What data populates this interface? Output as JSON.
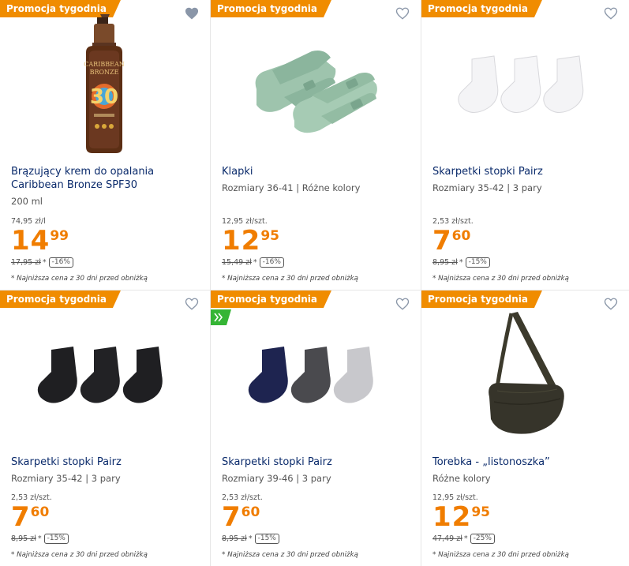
{
  "promo_label": "Promocja tygodnia",
  "colors": {
    "promo": "#f08c00",
    "price": "#f07d00",
    "title": "#0a2a6b",
    "green_badge": "#35b535"
  },
  "products": [
    {
      "promo": "Promocja tygodnia",
      "favorite_active": true,
      "image": "sunscreen-bottle-image",
      "title": "Brązujący krem do opalania Caribbean Bronze SPF30",
      "subtitle": "200 ml",
      "unit_price": "74,95 zł/l",
      "price_main": "14",
      "price_cents": "99",
      "old_price": "17,95 zł",
      "discount": "-16%",
      "note": "* Najniższa cena z 30 dni przed obniżką"
    },
    {
      "promo": "Promocja tygodnia",
      "favorite_active": false,
      "image": "slippers-image",
      "title": "Klapki",
      "subtitle": "Rozmiary 36-41 | Różne kolory",
      "unit_price": "12,95 zł/szt.",
      "price_main": "12",
      "price_cents": "95",
      "old_price": "15,49 zł",
      "discount": "-16%",
      "note": "* Najniższa cena z 30 dni przed obniżką"
    },
    {
      "promo": "Promocja tygodnia",
      "favorite_active": false,
      "image": "white-socks-image",
      "title": "Skarpetki stopki Pairz",
      "subtitle": "Rozmiary 35-42 | 3 pary",
      "unit_price": "2,53 zł/szt.",
      "price_main": "7",
      "price_cents": "60",
      "old_price": "8,95 zł",
      "discount": "-15%",
      "note": "* Najniższa cena z 30 dni przed obniżką"
    },
    {
      "promo": "Promocja tygodnia",
      "favorite_active": false,
      "image": "black-socks-image",
      "title": "Skarpetki stopki Pairz",
      "subtitle": "Rozmiary 35-42 | 3 pary",
      "unit_price": "2,53 zł/szt.",
      "price_main": "7",
      "price_cents": "60",
      "old_price": "8,95 zł",
      "discount": "-15%",
      "note": "* Najniższa cena z 30 dni przed obniżką"
    },
    {
      "promo": "Promocja tygodnia",
      "favorite_active": false,
      "green_badge": true,
      "image": "mixed-socks-image",
      "title": "Skarpetki stopki Pairz",
      "subtitle": "Rozmiary 39-46 | 3 pary",
      "unit_price": "2,53 zł/szt.",
      "price_main": "7",
      "price_cents": "60",
      "old_price": "8,95 zł",
      "discount": "-15%",
      "note": "* Najniższa cena z 30 dni przed obniżką"
    },
    {
      "promo": "Promocja tygodnia",
      "favorite_active": false,
      "image": "crossbody-bag-image",
      "title": "Torebka - „listonoszka”",
      "subtitle": "Różne kolory",
      "unit_price": "12,95 zł/szt.",
      "price_main": "12",
      "price_cents": "95",
      "old_price": "47,49 zł",
      "discount": "-25%",
      "note": "* Najniższa cena z 30 dni przed obniżką"
    }
  ]
}
